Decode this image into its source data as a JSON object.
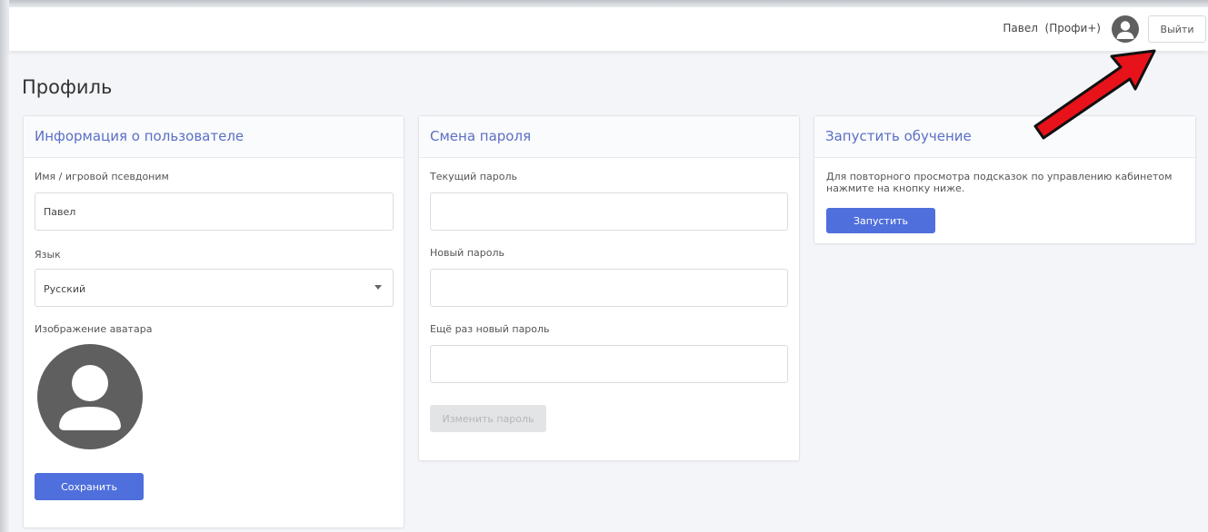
{
  "header": {
    "user_name": "Павел",
    "user_plan": "(Профи+)",
    "logout_label": "Выйти"
  },
  "page": {
    "title": "Профиль"
  },
  "user_info": {
    "title": "Информация о пользователе",
    "name_label": "Имя / игровой псевдоним",
    "name_value": "Павел",
    "language_label": "Язык",
    "language_value": "Русский",
    "avatar_label": "Изображение аватара",
    "save_label": "Сохранить"
  },
  "password": {
    "title": "Смена пароля",
    "current_label": "Текущий пароль",
    "new_label": "Новый пароль",
    "repeat_label": "Ещё раз новый пароль",
    "submit_label": "Изменить пароль"
  },
  "tutorial": {
    "title": "Запустить обучение",
    "hint": "Для повторного просмотра подсказок по управлению кабинетом нажмите на кнопку ниже.",
    "start_label": "Запустить"
  },
  "colors": {
    "accent": "#4f6fdc",
    "card_title": "#5b6fc4",
    "annotation_arrow": "#e8121a"
  }
}
